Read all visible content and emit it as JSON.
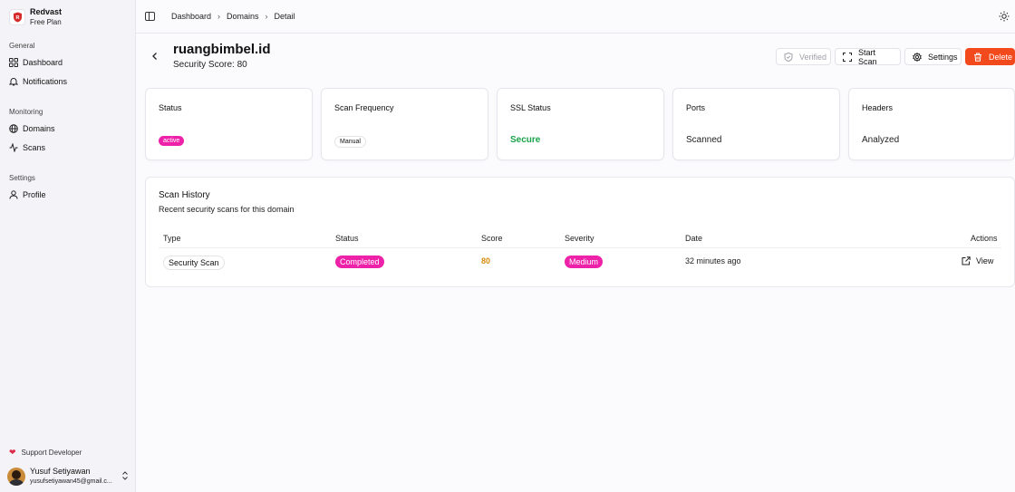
{
  "brand": {
    "name": "Redvast",
    "plan": "Free Plan"
  },
  "sidebar": {
    "groups": [
      {
        "label": "General",
        "items": [
          {
            "label": "Dashboard",
            "icon": "grid-icon"
          },
          {
            "label": "Notifications",
            "icon": "bell-icon"
          }
        ]
      },
      {
        "label": "Monitoring",
        "items": [
          {
            "label": "Domains",
            "icon": "globe-icon"
          },
          {
            "label": "Scans",
            "icon": "activity-icon"
          }
        ]
      },
      {
        "label": "Settings",
        "items": [
          {
            "label": "Profile",
            "icon": "user-icon"
          }
        ]
      }
    ],
    "support_label": "Support Developer",
    "user": {
      "name": "Yusuf Setiyawan",
      "email": "yusufsetiyawan45@gmail.c..."
    }
  },
  "breadcrumb": [
    "Dashboard",
    "Domains",
    "Detail"
  ],
  "header": {
    "domain": "ruangbimbel.id",
    "score_text": "Security Score: 80",
    "buttons": {
      "verified": "Verified",
      "start_scan": "Start Scan",
      "settings": "Settings",
      "delete": "Delete"
    }
  },
  "stats": {
    "status": {
      "title": "Status",
      "value": "active"
    },
    "frequency": {
      "title": "Scan Frequency",
      "value": "Manual"
    },
    "ssl": {
      "title": "SSL Status",
      "value": "Secure"
    },
    "ports": {
      "title": "Ports",
      "value": "Scanned"
    },
    "headers": {
      "title": "Headers",
      "value": "Analyzed"
    }
  },
  "history": {
    "title": "Scan History",
    "subtitle": "Recent security scans for this domain",
    "columns": [
      "Type",
      "Status",
      "Score",
      "Severity",
      "Date",
      "Actions"
    ],
    "rows": [
      {
        "type": "Security Scan",
        "status": "Completed",
        "score": "80",
        "severity": "Medium",
        "date": "32 minutes ago",
        "action": "View"
      }
    ]
  },
  "colors": {
    "accent_pink": "#ee22a9",
    "danger": "#f24a1d",
    "secure_green": "#18a34a",
    "score_orange": "#d98a0c"
  }
}
